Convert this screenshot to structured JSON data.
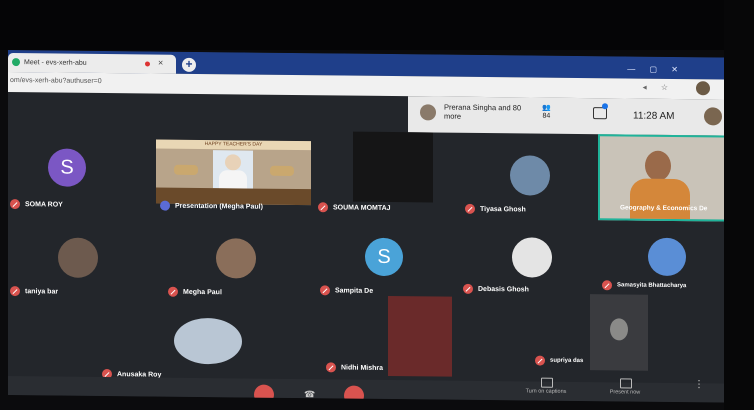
{
  "browser": {
    "tab_title": "Meet - evs-xerh-abu",
    "url": "om/evs-xerh-abu?authuser=0",
    "close_glyph": "×",
    "new_tab_glyph": "+"
  },
  "meet_header": {
    "people_text": "Prerana Singha and 80 more",
    "participant_count_icon": "people-icon",
    "participant_count": "84",
    "time": "11:28 AM"
  },
  "participants": [
    {
      "name": "SOMA ROY",
      "avatar_letter": "S",
      "avatar_color": "#7b57c4"
    },
    {
      "name": "Presentation (Megha Paul)",
      "banner": "HAPPY TEACHER'S DAY"
    },
    {
      "name": "SOUMA MOMTAJ"
    },
    {
      "name": "Tiyasa Ghosh"
    },
    {
      "name": "Geography & Economics De"
    },
    {
      "name": "taniya bar"
    },
    {
      "name": "Megha Paul"
    },
    {
      "name": "Sampita De",
      "avatar_letter": "S",
      "avatar_color": "#4aa3d8"
    },
    {
      "name": "Debasis Ghosh"
    },
    {
      "name": "Samasyita Bhattacharya"
    },
    {
      "name": "Anusaka Roy"
    },
    {
      "name": "Nidhi Mishra"
    },
    {
      "name": "supriya das"
    }
  ],
  "controls": {
    "turn_on_captions": "Turn on captions",
    "present_now": "Present now",
    "more_glyph": "⋮"
  },
  "colors": {
    "muted_red": "#d9534f",
    "speaking_border": "#1fb39a",
    "tab_bar": "#1f3f8a"
  }
}
